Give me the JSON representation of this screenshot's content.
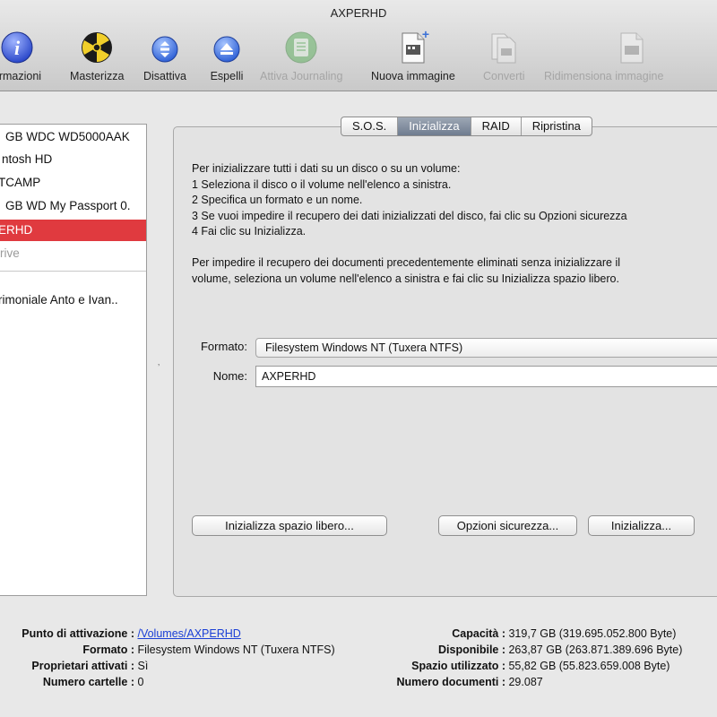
{
  "window": {
    "title": "AXPERHD"
  },
  "toolbar": {
    "items": [
      {
        "label": "Informazioni",
        "icon": "info-icon",
        "enabled": true
      },
      {
        "label": "Masterizza",
        "icon": "burn-icon",
        "enabled": true
      },
      {
        "label": "Disattiva",
        "icon": "unmount-icon",
        "enabled": true
      },
      {
        "label": "Espelli",
        "icon": "eject-icon",
        "enabled": true
      },
      {
        "label": "Attiva Journaling",
        "icon": "journaling-icon",
        "enabled": false
      },
      {
        "label": "Nuova immagine",
        "icon": "new-image-icon",
        "enabled": true
      },
      {
        "label": "Converti",
        "icon": "convert-icon",
        "enabled": false
      },
      {
        "label": "Ridimensiona immagine",
        "icon": "resize-image-icon",
        "enabled": false
      }
    ]
  },
  "sidebar": {
    "items": [
      {
        "label": "GB WDC WD5000AAK",
        "selected": false,
        "dim": false
      },
      {
        "label": "ntosh HD",
        "selected": false,
        "dim": false
      },
      {
        "label": "TCAMP",
        "selected": false,
        "dim": false
      },
      {
        "label": "GB WD My Passport 0.",
        "selected": false,
        "dim": false
      },
      {
        "label": "ERHD",
        "selected": true,
        "dim": false
      },
      {
        "label": "rive",
        "selected": false,
        "dim": true
      },
      {
        "label": "rimoniale Anto e Ivan..",
        "selected": false,
        "dim": false
      }
    ]
  },
  "tabs": [
    {
      "label": "S.O.S.",
      "active": false
    },
    {
      "label": "Inizializza",
      "active": true
    },
    {
      "label": "RAID",
      "active": false
    },
    {
      "label": "Ripristina",
      "active": false
    }
  ],
  "instructions": {
    "intro": "Per inizializzare tutti i dati su un disco o su un volume:",
    "step1": "1 Seleziona il disco o il volume nell'elenco a sinistra.",
    "step2": "2 Specifica un formato e un nome.",
    "step3": "3 Se vuoi impedire il recupero dei dati inizializzati del disco, fai clic su Opzioni sicurezza",
    "step4": "4 Fai clic su Inizializza.",
    "free1": "Per impedire il recupero dei documenti precedentemente eliminati senza inizializzare il",
    "free2": "volume, seleziona un volume nell'elenco a sinistra e fai clic su Inizializza spazio libero."
  },
  "form": {
    "format_label": "Formato:",
    "format_value": "Filesystem Windows NT (Tuxera NTFS)",
    "name_label": "Nome:",
    "name_value": "AXPERHD"
  },
  "buttons": {
    "erase_free_space": "Inizializza spazio libero...",
    "security_options": "Opzioni sicurezza...",
    "erase": "Inizializza..."
  },
  "info": {
    "mount_point_key": "Punto di attivazione :",
    "mount_point_value": "/Volumes/AXPERHD",
    "format_key": "Formato :",
    "format_value": "Filesystem Windows NT (Tuxera NTFS)",
    "owners_key": "Proprietari attivati :",
    "owners_value": "Sì",
    "folders_key": "Numero cartelle :",
    "folders_value": "0",
    "capacity_key": "Capacità :",
    "capacity_value": "319,7 GB (319.695.052.800 Byte)",
    "available_key": "Disponibile :",
    "available_value": "263,87 GB (263.871.389.696 Byte)",
    "used_key": "Spazio utilizzato :",
    "used_value": "55,82 GB (55.823.659.008 Byte)",
    "docs_key": "Numero documenti :",
    "docs_value": "29.087"
  },
  "colors": {
    "selection": "#e03a3f",
    "active_tab": "#7d8a9c",
    "link": "#1a3fd6"
  }
}
